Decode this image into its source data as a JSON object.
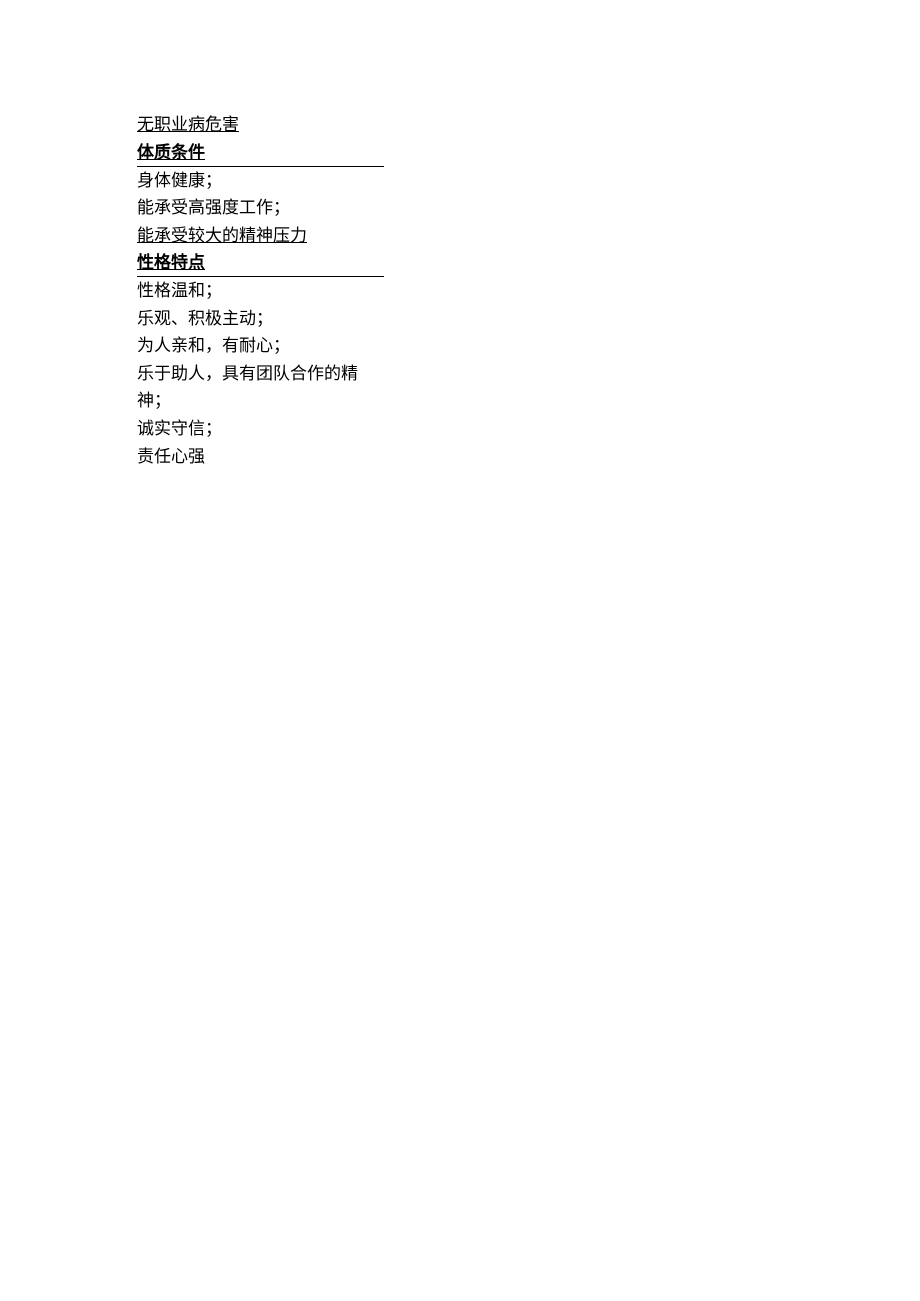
{
  "lines": {
    "occupational_hazard": "无职业病危害",
    "heading_physical": "体质条件",
    "physical_1": "身体健康；",
    "physical_2": "能承受高强度工作；",
    "physical_3": "能承受较大的精神压力",
    "heading_personality": "性格特点",
    "personality_1": "性格温和；",
    "personality_2": "乐观、积极主动；",
    "personality_3": "为人亲和，有耐心；",
    "personality_4": "乐于助人，具有团队合作的精神；",
    "personality_5": "诚实守信；",
    "personality_6": "责任心强"
  }
}
